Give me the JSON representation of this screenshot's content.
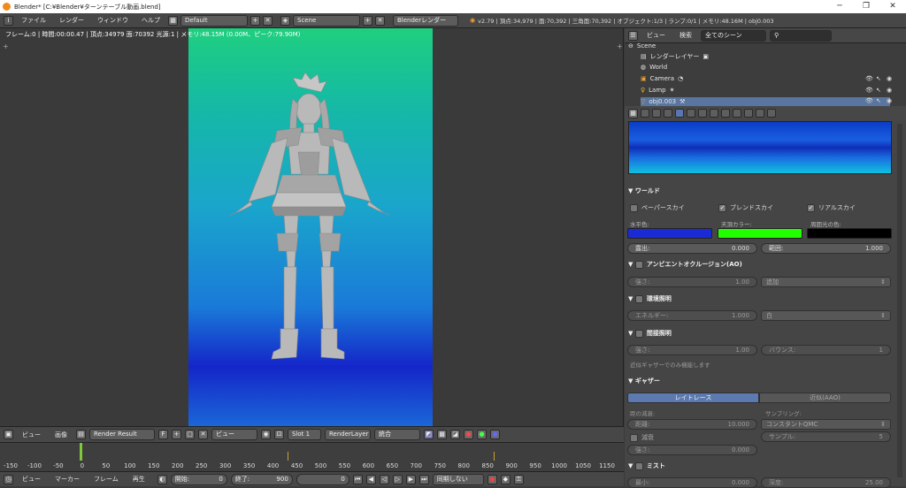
{
  "window": {
    "title": "Blender* [C:¥Blender¥ターンテーブル動画.blend]"
  },
  "topbar": {
    "menus": [
      "ファイル",
      "レンダー",
      "ウィンドウ",
      "ヘルプ"
    ],
    "layout": "Default",
    "scene": "Scene",
    "engine": "Blenderレンダー",
    "stats": "v2.79 | 頂点:34,979 | 面:70,392 | 三角面:70,392 | オブジェクト:1/3 | ランプ:0/1 | メモリ:48.16M | obj0.003"
  },
  "viewport": {
    "info": "フレーム:0 | 時間:00:00.47 | 頂点:34979 面:70392 光源:1 | メモリ:48.15M (0.00M、ピーク:79.90M)"
  },
  "image_header": {
    "view": "ビュー",
    "image": "画像",
    "image_name": "Render Result",
    "fake_user": "F",
    "view2": "ビュー",
    "slot": "Slot 1",
    "layer": "RenderLayer",
    "pass": "統合"
  },
  "timeline": {
    "ticks": [
      "-150",
      "-100",
      "-50",
      "0",
      "50",
      "100",
      "150",
      "200",
      "250",
      "300",
      "350",
      "400",
      "450",
      "500",
      "550",
      "600",
      "650",
      "700",
      "750",
      "800",
      "850",
      "900",
      "950",
      "1000",
      "1050",
      "1150"
    ]
  },
  "timeline_header": {
    "view": "ビュー",
    "marker": "マーカー",
    "frame": "フレーム",
    "playback": "再生",
    "start_label": "開始:",
    "start_value": "0",
    "end_label": "終了:",
    "end_value": "900",
    "current_value": "0",
    "sync": "同期しない"
  },
  "outliner": {
    "view": "ビュー",
    "search": "検索",
    "filter": "全てのシーン",
    "items": [
      "Scene",
      "レンダーレイヤー",
      "World",
      "Camera",
      "Lamp",
      "obj0.003"
    ]
  },
  "world": {
    "title": "ワールド",
    "paper_sky": "ペーパースカイ",
    "blend_sky": "ブレンドスカイ",
    "real_sky": "リアルスカイ",
    "horizon_label": "水平色:",
    "zenith_label": "天頂カラー:",
    "ambient_label": "周囲光の色:",
    "horizon_color": "#1a2bd6",
    "zenith_color": "#22ff00",
    "ambient_color": "#000000",
    "exposure_label": "露出:",
    "exposure_value": "0.000",
    "range_label": "範囲:",
    "range_value": "1.000"
  },
  "ao": {
    "title": "アンビエントオクルージョン(AO)",
    "strength_label": "強さ:",
    "strength_value": "1.00",
    "mode": "追加"
  },
  "env": {
    "title": "環境照明",
    "energy_label": "エネルギー:",
    "energy_value": "1.000",
    "mode": "白"
  },
  "indirect": {
    "title": "間接照明",
    "strength_label": "強さ:",
    "strength_value": "1.00",
    "bounce_label": "バウンス:",
    "bounce_value": "1",
    "note": "近似ギャザーでのみ機能します"
  },
  "gather": {
    "title": "ギャザー",
    "tab_raytrace": "レイトレース",
    "tab_approx": "近似(AAO)",
    "attenuation": "距の減衰:",
    "distance_label": "距離:",
    "distance_value": "10.000",
    "falloff": "減衰",
    "strength_label": "強さ:",
    "strength_value": "0.000",
    "sampling_label": "サンプリング:",
    "sampling_value": "コンスタントQMC",
    "samples_label": "サンプル:",
    "samples_value": "5"
  },
  "mist": {
    "title": "ミスト",
    "min_label": "最小:",
    "min_value": "0.000",
    "depth_label": "深度:",
    "depth_value": "25.00"
  }
}
